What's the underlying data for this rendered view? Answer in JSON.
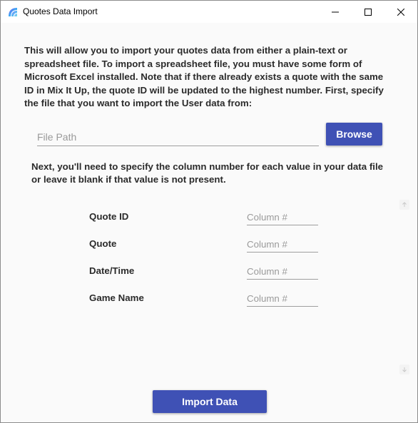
{
  "window": {
    "title": "Quotes Data Import"
  },
  "intro": {
    "text": "This will allow you to import your quotes data from either a plain-text or spreadsheet file. To import a spreadsheet file, you must have some form of Microsoft Excel installed. Note that if there already exists a quote with the same ID in Mix It Up, the quote ID will be updated to the highest number. First, specify the file that you want to import the User data from:"
  },
  "file": {
    "placeholder": "File Path",
    "value": "",
    "browse_label": "Browse"
  },
  "columns": {
    "instructions": "Next, you'll need to specify the column number for each value in your data file or leave it blank if that value is not present.",
    "fields": [
      {
        "label": "Quote ID",
        "placeholder": "Column #",
        "value": ""
      },
      {
        "label": "Quote",
        "placeholder": "Column #",
        "value": ""
      },
      {
        "label": "Date/Time",
        "placeholder": "Column #",
        "value": ""
      },
      {
        "label": "Game Name",
        "placeholder": "Column #",
        "value": ""
      }
    ]
  },
  "actions": {
    "import_label": "Import Data"
  },
  "colors": {
    "accent": "#3f51b5",
    "background": "#fafafa",
    "text": "#2b2b2b"
  },
  "icons": {
    "app": "mix-it-up-logo-icon",
    "minimize": "minimize-icon",
    "maximize": "maximize-icon",
    "close": "close-icon",
    "scroll_up": "arrow-up-icon",
    "scroll_down": "arrow-down-icon"
  }
}
